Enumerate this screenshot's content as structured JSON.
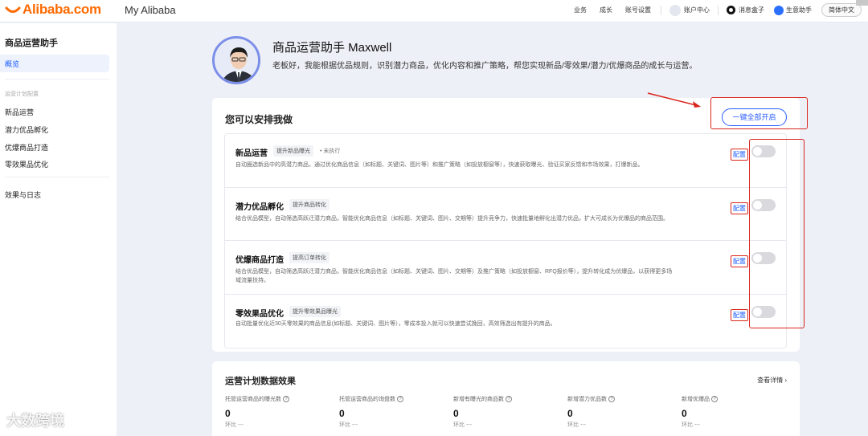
{
  "topbar": {
    "logo_text": "Alibaba.com",
    "brand_title": "My Alibaba",
    "nav": [
      "业务",
      "成长",
      "账号设置"
    ],
    "account_label": "账户中心",
    "messages_label": "消息盒子",
    "assistant_label": "生意助手",
    "language_label": "简体中文"
  },
  "sidebar": {
    "title": "商品运营助手",
    "active_item": "概览",
    "section_label": "运营计划配置",
    "items": [
      "新品运营",
      "潜力优品孵化",
      "优爆商品打造",
      "零效果品优化"
    ],
    "bottom_item": "效果与日志"
  },
  "header": {
    "title": "商品运营助手 Maxwell",
    "description": "老板好，我能根据优品规则，识别潜力商品，优化内容和推广策略，帮您实现新品/零效果/潜力/优爆商品的成长与运营。"
  },
  "tasks_card": {
    "title": "您可以安排我做",
    "enable_all_label": "一键全部开启",
    "tasks": [
      {
        "name": "新品运营",
        "tag": "提升新品曝光",
        "status": "• 未执行",
        "description": "自动圈选新品中的高潜力商品，通过优化商品信息（如标题、关键词、图片等）和推广策略（如投放橱窗等），快速获取曝光、验证买家反馈和市场效果，打爆新品。",
        "config_label": "配置"
      },
      {
        "name": "潜力优品孵化",
        "tag": "提升商品转化",
        "status": "",
        "description": "结合优品模型，自动筛选高跃迁潜力商品，智能优化商品信息（如标题、关键词、图片、交期等）提升竞争力，快速批量地孵化出潜力优品，扩大可成长为优爆品的商品范围。",
        "config_label": "配置"
      },
      {
        "name": "优爆商品打造",
        "tag": "提高订单转化",
        "status": "",
        "description": "结合优品模型，自动筛选高跃迁潜力商品，智能优化商品信息（如标题、关键词、图片、交期等）及推广策略（如投放橱窗、RFQ报价等），提升转化成为优爆品，以获得更多场域流量扶持。",
        "config_label": "配置"
      },
      {
        "name": "零效果品优化",
        "tag": "提升零效果品曝光",
        "status": "",
        "description": "自动批量优化近30天零效果的商品信息(如标题、关键词、图片等），零成本投入就可以快速尝试挽回，高效筛选出有提升的商品。",
        "config_label": "配置"
      }
    ]
  },
  "stats_card": {
    "title": "运营计划数据效果",
    "more_label": "查看详情",
    "metrics": [
      {
        "label": "托管运营商品的曝光数",
        "value": "0",
        "yoy_label": "环比",
        "yoy_value": "---"
      },
      {
        "label": "托管运营商品的询盘数",
        "value": "0",
        "yoy_label": "环比",
        "yoy_value": "---"
      },
      {
        "label": "新增有曝光的商品数",
        "value": "0",
        "yoy_label": "环比",
        "yoy_value": "---"
      },
      {
        "label": "新增潜力优品数",
        "value": "0",
        "yoy_label": "环比",
        "yoy_value": "---"
      },
      {
        "label": "新增优爆品",
        "value": "0",
        "yoy_label": "环比",
        "yoy_value": "---"
      }
    ]
  },
  "watermark": "大数跨境",
  "colors": {
    "accent": "#1a5cff",
    "annotation": "#d9261c",
    "brand": "#ff6a00"
  }
}
